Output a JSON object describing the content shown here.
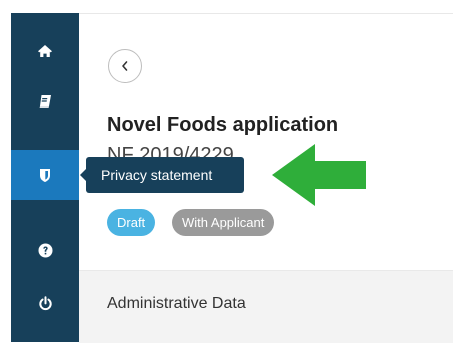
{
  "sidebar": {
    "items": [
      {
        "icon": "home-icon",
        "name": "sidebar-item-home"
      },
      {
        "icon": "book-icon",
        "name": "sidebar-item-book"
      },
      {
        "icon": "shield-icon",
        "name": "sidebar-item-privacy",
        "active": true
      },
      {
        "icon": "help-icon",
        "name": "sidebar-item-help"
      },
      {
        "icon": "power-icon",
        "name": "sidebar-item-logout"
      }
    ],
    "active_color": "#1b79bd",
    "background_color": "#17405a"
  },
  "header": {
    "back_icon": "chevron-left-icon",
    "title": "Novel Foods application",
    "reference": "NF 2019/4229"
  },
  "badges": [
    {
      "label": "Draft",
      "color": "#4ab3e2"
    },
    {
      "label": "With Applicant",
      "color": "#9a9a9a"
    }
  ],
  "tooltip": {
    "text": "Privacy statement"
  },
  "annotation": {
    "icon": "arrow-left-icon",
    "color": "#2fae3a"
  },
  "section": {
    "label": "Administrative Data"
  }
}
